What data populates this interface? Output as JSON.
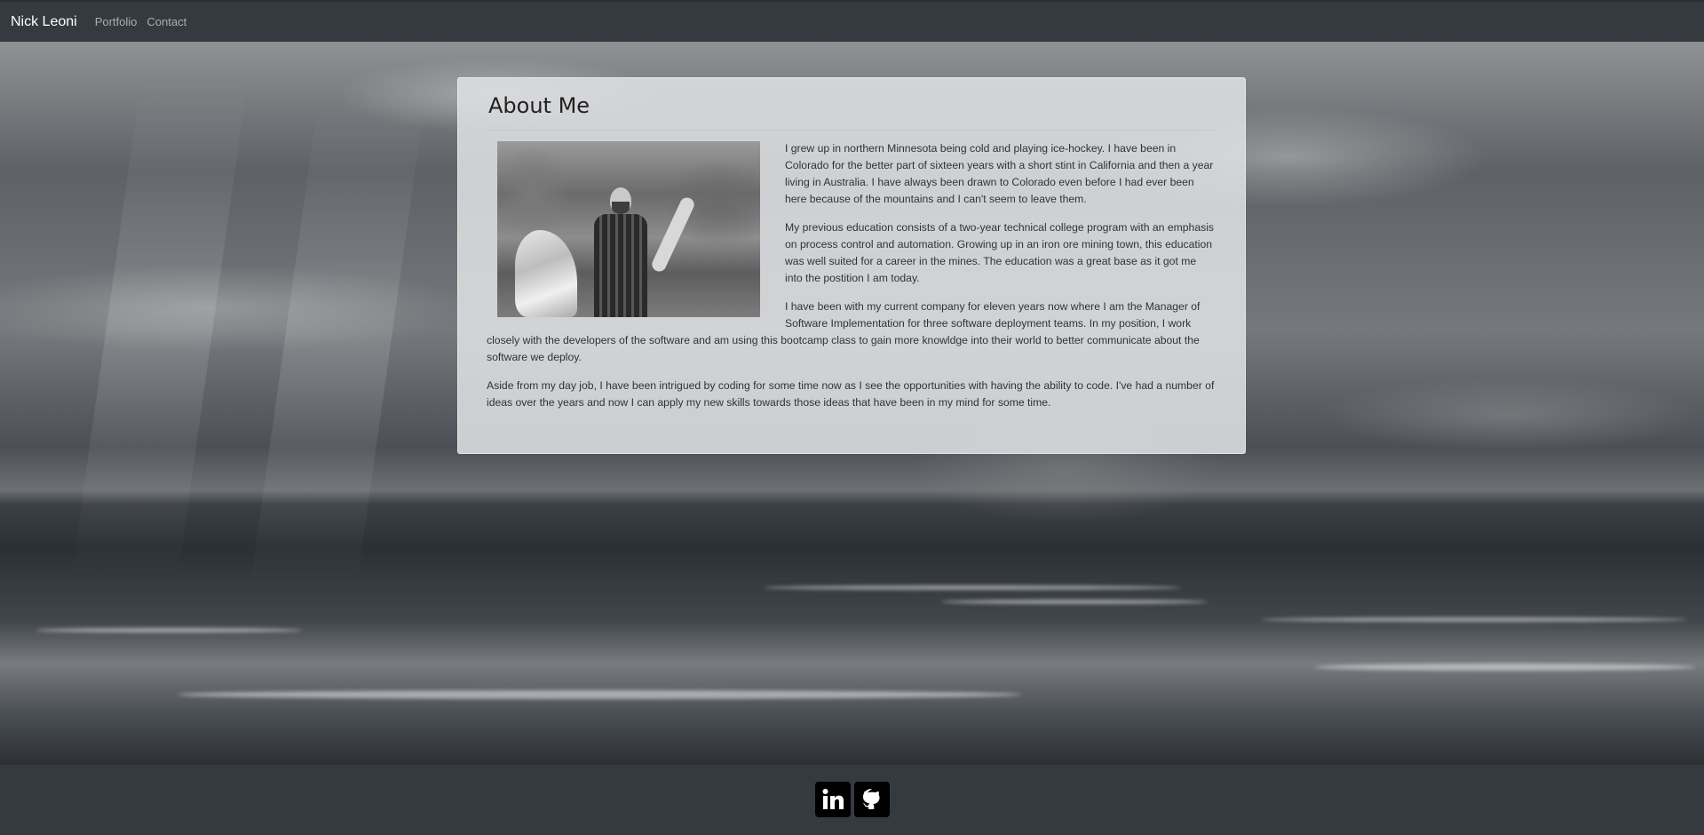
{
  "nav": {
    "brand": "Nick Leoni",
    "links": [
      "Portfolio",
      "Contact"
    ]
  },
  "about": {
    "title": "About Me",
    "paragraphs": [
      "I grew up in northern Minnesota being cold and playing ice-hockey. I have been in Colorado for the better part of sixteen years with a short stint in California and then a year living in Australia. I have always been drawn to Colorado even before I had ever been here because of the mountains and I can't seem to leave them.",
      "My previous education consists of a two-year technical college program with an emphasis on process control and automation. Growing up in an iron ore mining town, this education was well suited for a career in the mines. The education was a great base as it got me into the postition I am today.",
      "I have been with my current company for eleven years now where I am the Manager of Software Implementation for three software deployment teams. In my position, I work closely with the developers of the software and am using this bootcamp class to gain more knowldge into their world to better communicate about the software we deploy.",
      "Aside from my day job, I have been intrigued by coding for some time now as I see the opportunities with having the ability to code. I've had a number of ideas over the years and now I can apply my new skills towards those ideas that have been in my mind for some time."
    ]
  },
  "footer": {
    "icons": [
      "linkedin-icon",
      "github-icon"
    ]
  },
  "colors": {
    "navbar": "#343a40",
    "brand": "#ffffff",
    "nav_link": "#a9adb2",
    "card_bg": "#dedfe1"
  }
}
